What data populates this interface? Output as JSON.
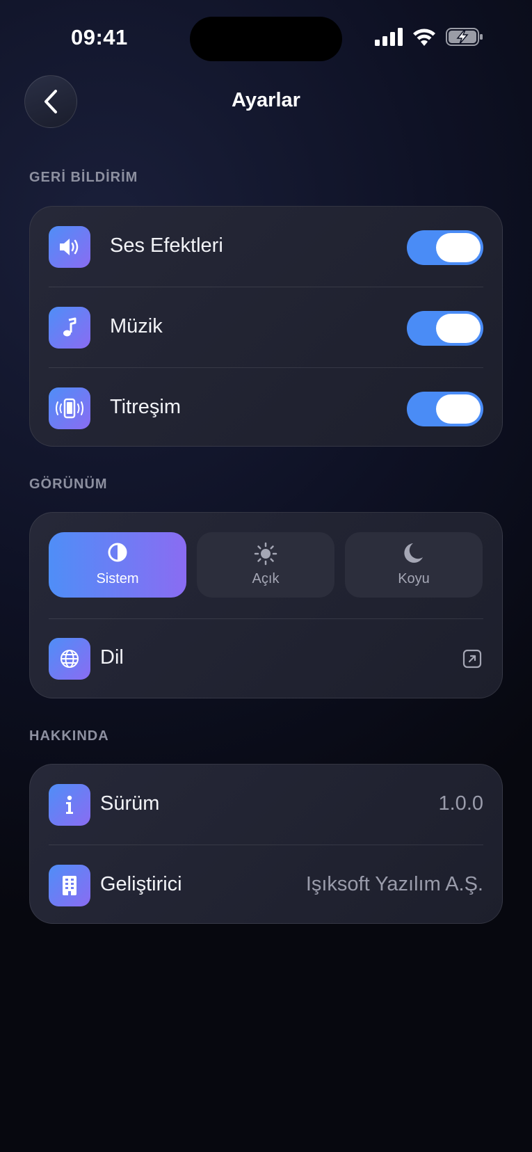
{
  "status": {
    "time": "09:41"
  },
  "header": {
    "title": "Ayarlar"
  },
  "sections": {
    "feedback": {
      "label": "GERİ BİLDİRİM",
      "items": [
        {
          "label": "Ses Efektleri",
          "icon": "speaker-icon",
          "enabled": true
        },
        {
          "label": "Müzik",
          "icon": "music-note-icon",
          "enabled": true
        },
        {
          "label": "Titreşim",
          "icon": "vibration-icon",
          "enabled": true
        }
      ]
    },
    "appearance": {
      "label": "GÖRÜNÜM",
      "themes": [
        {
          "label": "Sistem",
          "icon": "half-circle-icon",
          "selected": true
        },
        {
          "label": "Açık",
          "icon": "sun-icon",
          "selected": false
        },
        {
          "label": "Koyu",
          "icon": "moon-icon",
          "selected": false
        }
      ],
      "language": {
        "label": "Dil",
        "icon": "globe-icon",
        "action_icon": "external-link-icon"
      }
    },
    "about": {
      "label": "HAKKINDA",
      "items": [
        {
          "label": "Sürüm",
          "value": "1.0.0",
          "icon": "info-icon"
        },
        {
          "label": "Geliştirici",
          "value": "Işıksoft Yazılım A.Ş.",
          "icon": "building-icon"
        }
      ]
    }
  },
  "colors": {
    "accent_start": "#4f8ef7",
    "accent_end": "#8a6cf2",
    "toggle_on": "#4a8cf6",
    "background": "#0e1124",
    "card": "#232534"
  }
}
